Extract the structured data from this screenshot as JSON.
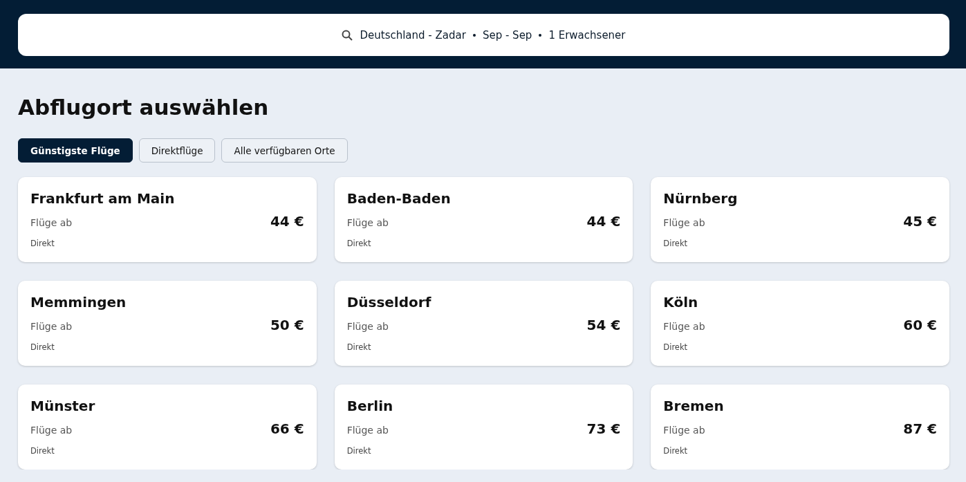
{
  "search": {
    "route": "Deutschland - Zadar",
    "dates": "Sep - Sep",
    "travellers": "1 Erwachsener"
  },
  "heading": "Abflugort auswählen",
  "filters": [
    {
      "label": "Günstigste Flüge",
      "selected": true
    },
    {
      "label": "Direktflüge",
      "selected": false
    },
    {
      "label": "Alle verfügbaren Orte",
      "selected": false
    }
  ],
  "cards": [
    {
      "city": "Frankfurt am Main",
      "caption": "Flüge ab",
      "price": "44 €",
      "note": "Direkt"
    },
    {
      "city": "Baden-Baden",
      "caption": "Flüge ab",
      "price": "44 €",
      "note": "Direkt"
    },
    {
      "city": "Nürnberg",
      "caption": "Flüge ab",
      "price": "45 €",
      "note": "Direkt"
    },
    {
      "city": "Memmingen",
      "caption": "Flüge ab",
      "price": "50 €",
      "note": "Direkt"
    },
    {
      "city": "Düsseldorf",
      "caption": "Flüge ab",
      "price": "54 €",
      "note": "Direkt"
    },
    {
      "city": "Köln",
      "caption": "Flüge ab",
      "price": "60 €",
      "note": "Direkt"
    },
    {
      "city": "Münster",
      "caption": "Flüge ab",
      "price": "66 €",
      "note": "Direkt"
    },
    {
      "city": "Berlin",
      "caption": "Flüge ab",
      "price": "73 €",
      "note": "Direkt"
    },
    {
      "city": "Bremen",
      "caption": "Flüge ab",
      "price": "87 €",
      "note": "Direkt"
    }
  ]
}
